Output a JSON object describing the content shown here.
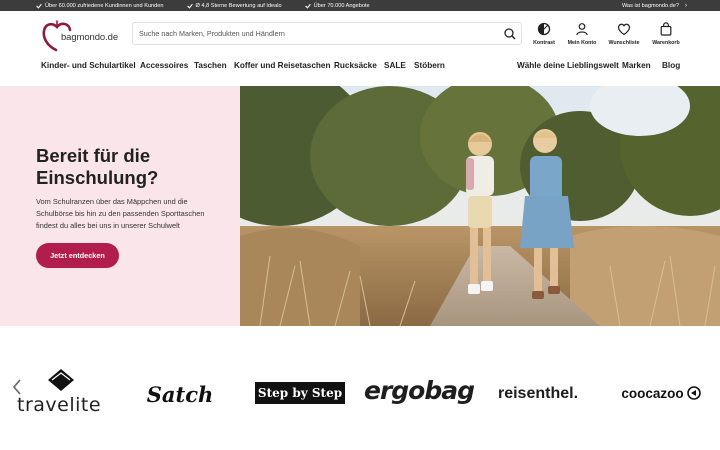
{
  "topbar": {
    "usps": [
      "Über 60.000 zufriedene Kundinnen und Kunden",
      "Ø 4,8 Sterne Bewertung auf Idealo",
      "Über 70.000 Angebote"
    ],
    "about_link": "Was ist bagmondo.de?"
  },
  "header": {
    "logo_text": "bagmondo.de",
    "search_placeholder": "Suche nach Marken, Produkten und Händlern",
    "actions": {
      "contrast": "Kontrast",
      "account": "Mein Konto",
      "wishlist": "Wunschliste",
      "cart": "Warenkorb"
    }
  },
  "nav": {
    "items": [
      "Kinder- und Schulartikel",
      "Accessoires",
      "Taschen",
      "Koffer und Reisetaschen",
      "Rucksäcke",
      "SALE",
      "Stöbern"
    ],
    "right_items": [
      "Wähle deine Lieblingswelt",
      "Marken",
      "Blog"
    ]
  },
  "hero": {
    "title": "Bereit für die Einschulung?",
    "text": "Vom Schulranzen über das Mäppchen und die Schulbörse bis hin zu den passenden Sporttaschen findest du alles bei uns in unserer Schulwelt",
    "cta": "Jetzt entdecken"
  },
  "brands": {
    "items": [
      "travelite",
      "Satch",
      "Step by Step",
      "ergobag",
      "reisenthel.",
      "coocazoo"
    ]
  },
  "colors": {
    "accent": "#b11d4d",
    "hero_bg": "#fae6ea",
    "topbar_bg": "#3c3c3c"
  },
  "icons": {
    "check": "check-icon",
    "search": "search-icon",
    "contrast": "contrast-icon",
    "account": "user-icon",
    "wishlist": "heart-icon",
    "cart": "shopping-bag-icon",
    "prev": "chevron-left-icon"
  }
}
